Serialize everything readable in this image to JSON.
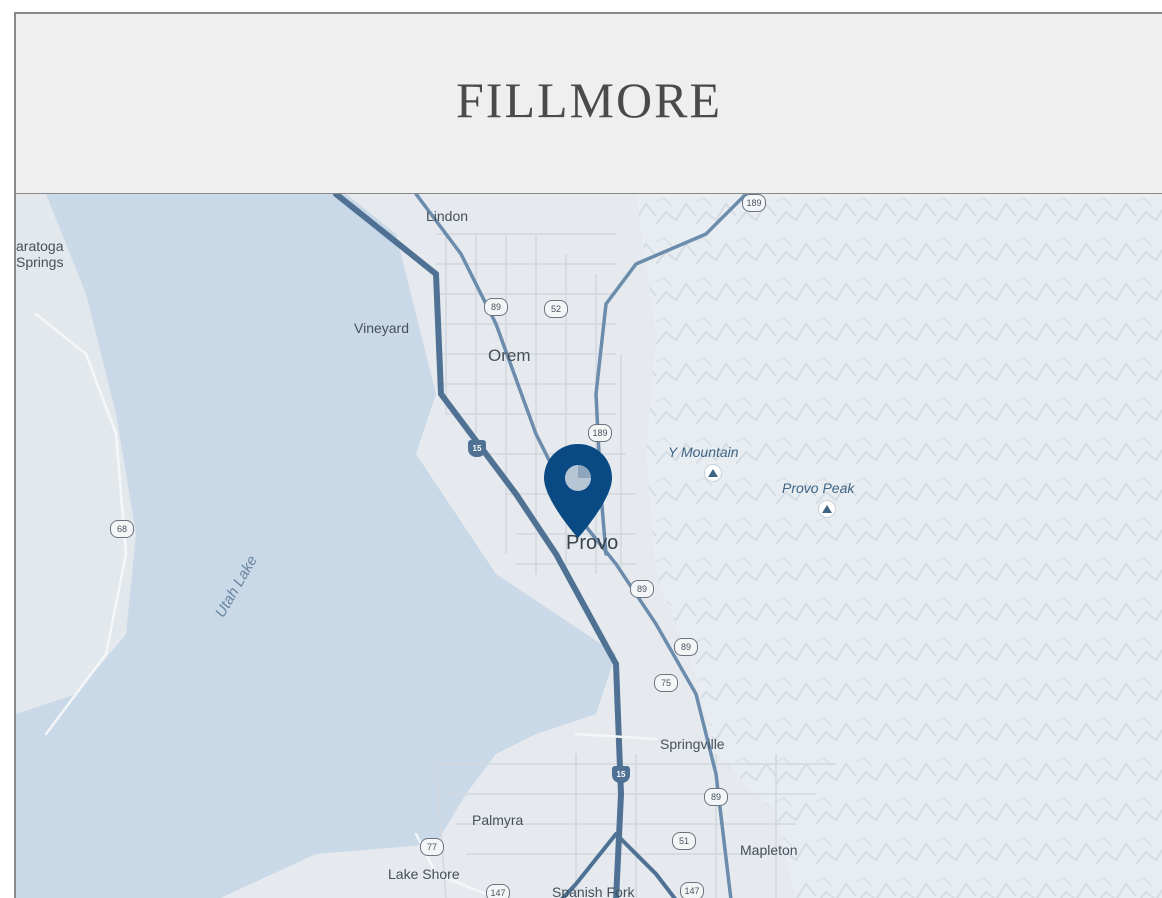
{
  "header": {
    "title": "FILLMORE"
  },
  "map": {
    "water_color": "#c9d9e8",
    "land_color": "#e6eaee",
    "road_color": "#5b7fa3",
    "pin_color": "#0a4a84",
    "places": {
      "saratoga": "aratoga\nSprings",
      "lindon": "Lindon",
      "vineyard": "Vineyard",
      "orem": "Orem",
      "provo": "Provo",
      "springville": "Springville",
      "palmyra": "Palmyra",
      "mapleton": "Mapleton",
      "lake_shore": "Lake Shore",
      "spanish_fork": "Spanish Fork"
    },
    "water": {
      "utah_lake": "Utah Lake"
    },
    "peaks": {
      "y_mountain": "Y Mountain",
      "provo_peak": "Provo Peak"
    },
    "shields": {
      "us189_top": "189",
      "us89_a": "89",
      "sr52": "52",
      "us189_mid": "189",
      "i15_a": "15",
      "sr68": "68",
      "us89_b": "89",
      "us89_c": "89",
      "sr75": "75",
      "i15_b": "15",
      "us89_d": "89",
      "sr77": "77",
      "sr51": "51",
      "sr147_a": "147",
      "sr147_b": "147"
    },
    "marker_icon": "map-pin-icon"
  }
}
